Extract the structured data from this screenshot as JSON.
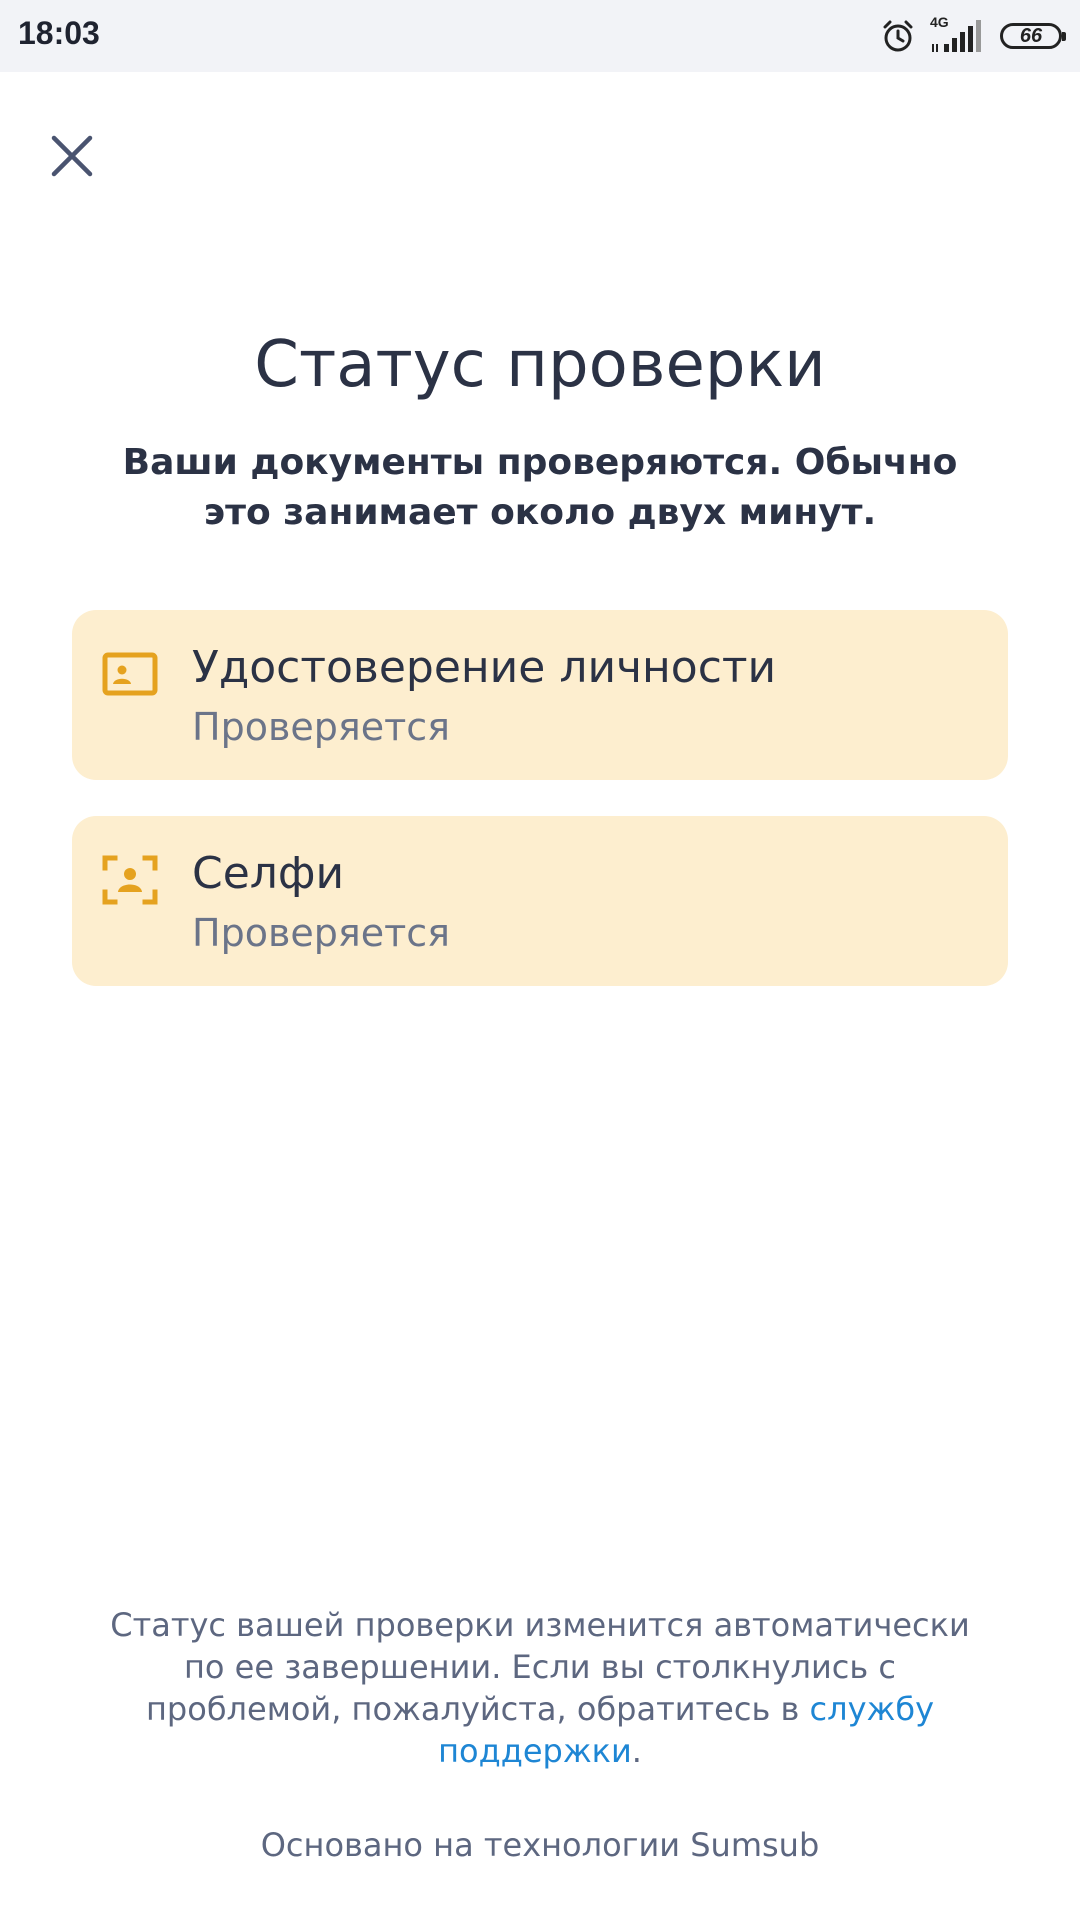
{
  "status_bar": {
    "time": "18:03",
    "network": "4G",
    "battery": "66"
  },
  "icons": {
    "close": "close-icon",
    "id_card": "id-card-icon",
    "selfie": "selfie-frame-icon",
    "alarm": "alarm-icon",
    "signal": "signal-icon",
    "battery": "battery-icon"
  },
  "header": {
    "title": "Статус проверки",
    "subtitle": "Ваши документы проверяются. Обычно это занимает около двух минут."
  },
  "documents": [
    {
      "title": "Удостоверение личности",
      "status": "Проверяется"
    },
    {
      "title": "Селфи",
      "status": "Проверяется"
    }
  ],
  "footer": {
    "note_text": "Статус вашей проверки изменится автоматически по ее завершении. Если вы столкнулись с проблемой, пожалуйста, обратитесь в ",
    "link_text": "службу поддержки",
    "note_end": ".",
    "powered_by": "Основано на технологии Sumsub"
  },
  "colors": {
    "card_background": "#fdeecf",
    "card_icon": "#e5a21f",
    "link": "#1e86d4",
    "text_primary": "#2b3245",
    "text_secondary": "#6b7489"
  }
}
